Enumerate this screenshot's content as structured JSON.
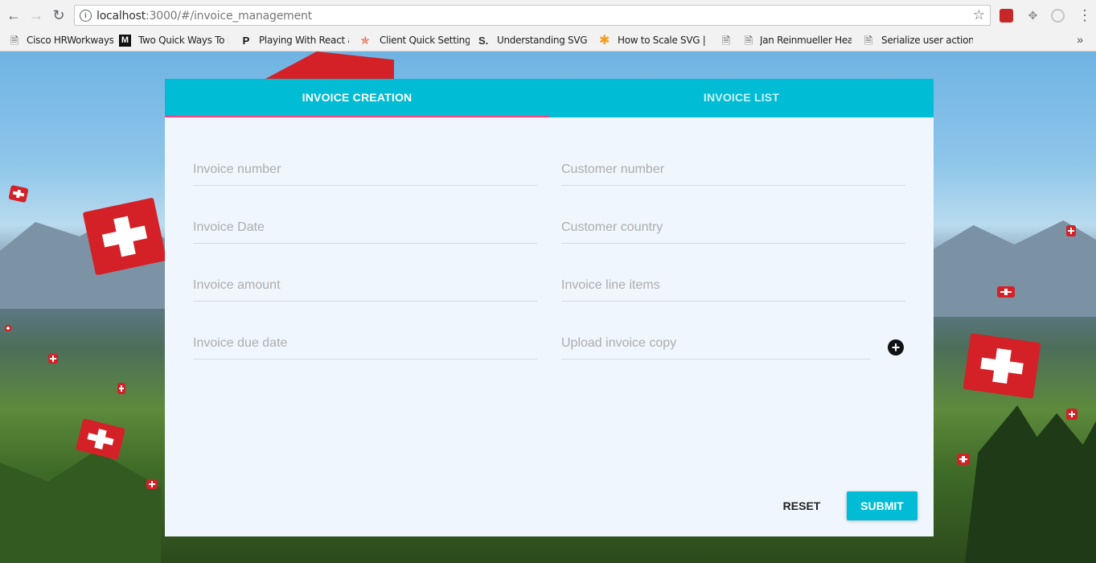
{
  "browser": {
    "url_host": "localhost",
    "url_rest": ":3000/#/invoice_management",
    "bookmarks": [
      {
        "label": "Cisco HRWorkways",
        "icon": "page-icon"
      },
      {
        "label": "Two Quick Ways To R",
        "icon": "medium-icon"
      },
      {
        "label": "Playing With React ar",
        "icon": "p-icon"
      },
      {
        "label": "Client Quick Settings",
        "icon": "auth0-icon"
      },
      {
        "label": "Understanding SVG C",
        "icon": "s-icon"
      },
      {
        "label": "How to Scale SVG | C",
        "icon": "asterisk-icon"
      },
      {
        "label": "",
        "icon": "page-icon"
      },
      {
        "label": "Jan Reinmueller Heac",
        "icon": "page-icon"
      },
      {
        "label": "Serialize user actions",
        "icon": "page-icon"
      }
    ],
    "more_label": "»"
  },
  "tabs": {
    "creation": "INVOICE CREATION",
    "list": "INVOICE LIST"
  },
  "form": {
    "invoice_number": "Invoice number",
    "customer_number": "Customer number",
    "invoice_date": "Invoice Date",
    "customer_country": "Customer country",
    "invoice_amount": "Invoice amount",
    "invoice_line_items": "Invoice line items",
    "invoice_due_date": "Invoice due date",
    "upload_invoice_copy": "Upload invoice copy"
  },
  "actions": {
    "reset": "RESET",
    "submit": "SUBMIT"
  },
  "colors": {
    "tab_bar": "#00bcd4",
    "tab_indicator": "#ff4081",
    "card_bg": "#eff6fd",
    "submit_bg": "#00bcd4"
  }
}
